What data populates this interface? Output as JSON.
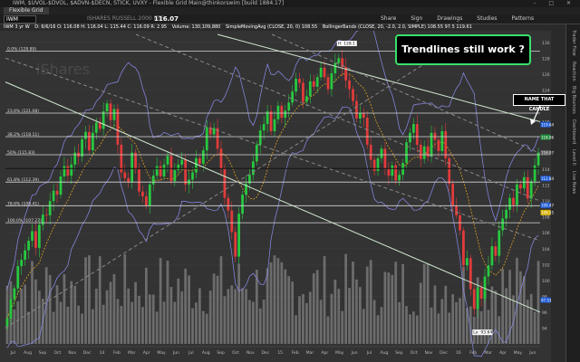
{
  "window": {
    "title": "IWM, $UVOL-$DVOL, $ADVN-$DECN, STICK, UVXY - Flexible Grid Main@thinkorswim [build 1884.17]",
    "controls": "–  □  ✕"
  },
  "tabs": [
    {
      "label": "Flexible Grid"
    }
  ],
  "toolbar": {
    "symbol": "IWM",
    "description": "ISHARES RUSSELL 2000 ETF",
    "last_price": "116.07",
    "buttons": [
      "Share",
      "Sign",
      "Drawings",
      "Studies",
      "Patterns"
    ]
  },
  "studybar": {
    "period": "IWM 3 yr W",
    "quote": "D: 6/6/16  O: 116.08  H: 116.04  L: 115.44  C: 116.09  R: 2.95",
    "volume": "Volume: 130,109,880",
    "sma": "SimpleMovingAvg (CLOSE, 20, 0)  108.55",
    "bollinger": "BollingerBands (CLOSE, 20, -2.0, 2.0, SIMPLE)  108.55  97.5  119.61"
  },
  "annotations": {
    "headline": "Trendlines still work ?",
    "candle_note": "NAME THAT CANDLE",
    "high_label": "H: 128.1",
    "low_label": "Lo: 93.64"
  },
  "sidepanel": {
    "labels": [
      "Trader Flow",
      "Reaction",
      "Big Bounces",
      "Dashboard",
      "Level II",
      "Live News"
    ]
  },
  "chart_data": {
    "type": "candlestick",
    "title": "IWM 3 yr W",
    "xlabel": "",
    "ylabel": "",
    "ylim": [
      92,
      131
    ],
    "x_tick_labels": [
      "Jul",
      "Aug",
      "Sep",
      "Oct",
      "Nov",
      "Dec",
      "14",
      "Feb",
      "Mar",
      "Apr",
      "May",
      "Jun",
      "Jul",
      "Aug",
      "Sep",
      "Oct",
      "Nov",
      "Dec",
      "15",
      "Feb",
      "Mar",
      "Apr",
      "May",
      "Jun",
      "Jul",
      "Aug",
      "Sep",
      "Oct",
      "Nov",
      "Dec",
      "16",
      "Feb",
      "Mar",
      "Apr",
      "May",
      "Jun"
    ],
    "y_tick_labels": [
      94,
      96,
      98,
      100,
      102,
      104,
      106,
      108,
      110,
      112,
      114,
      116,
      118,
      120,
      122,
      124,
      126,
      128,
      130
    ],
    "fibonacci_levels": [
      {
        "label": "0.0% (128.89)",
        "value": 128.89
      },
      {
        "label": "23.6% (121.08)",
        "value": 121.08
      },
      {
        "label": "38.2% (118.11)",
        "value": 118.11
      },
      {
        "label": "50% (115.83)",
        "value": 115.83
      },
      {
        "label": "61.8% (112.39)",
        "value": 112.39
      },
      {
        "label": "78.6% (109.41)",
        "value": 109.41
      },
      {
        "label": "100.0% (107.27)",
        "value": 107.27
      }
    ],
    "price_badges": [
      {
        "value": "119.64",
        "color": "#1e5bd8"
      },
      {
        "value": "118.06",
        "color": "#1f8a3c"
      },
      {
        "value": "116.07",
        "color": "#5a5a5a"
      },
      {
        "value": "112.84",
        "color": "#1e5bd8"
      },
      {
        "value": "109.47",
        "color": "#1e5bd8"
      },
      {
        "value": "108.55",
        "color": "#d9b300"
      },
      {
        "value": "97.53",
        "color": "#1e5bd8"
      }
    ],
    "closes": [
      95.2,
      97.6,
      99.0,
      101.8,
      102.6,
      103.8,
      105.0,
      106.2,
      104.1,
      107.0,
      108.3,
      108.2,
      110.0,
      111.3,
      110.8,
      113.1,
      114.4,
      113.2,
      114.6,
      116.1,
      115.6,
      117.8,
      118.7,
      116.4,
      118.6,
      119.9,
      119.1,
      121.3,
      122.3,
      120.2,
      121.6,
      117.1,
      113.6,
      112.9,
      112.4,
      116.1,
      114.0,
      111.2,
      110.6,
      109.4,
      112.1,
      113.2,
      114.4,
      113.1,
      114.6,
      115.7,
      112.5,
      113.9,
      114.6,
      115.2,
      112.1,
      112.7,
      113.6,
      115.4,
      114.7,
      116.4,
      119.3,
      118.4,
      119.2,
      116.6,
      114.1,
      110.4,
      108.8,
      106.1,
      103.0,
      108.4,
      110.8,
      112.2,
      113.3,
      115.0,
      117.1,
      118.9,
      119.7,
      121.3,
      118.8,
      120.3,
      122.0,
      120.5,
      121.4,
      122.4,
      123.8,
      125.4,
      124.9,
      122.5,
      123.2,
      125.1,
      124.4,
      125.6,
      126.8,
      125.6,
      124.1,
      126.1,
      127.4,
      128.0,
      126.9,
      125.2,
      124.1,
      122.6,
      120.4,
      121.1,
      120.5,
      117.1,
      115.2,
      113.8,
      115.4,
      116.6,
      114.1,
      113.2,
      114.5,
      112.6,
      113.3,
      114.8,
      117.4,
      118.6,
      119.7,
      117.1,
      115.3,
      116.9,
      115.6,
      118.6,
      117.7,
      116.3,
      118.8,
      115.4,
      112.2,
      109.4,
      108.2,
      106.3,
      101.9,
      102.8,
      98.9,
      96.4,
      99.1,
      97.7,
      100.5,
      101.9,
      104.3,
      103.1,
      106.3,
      107.8,
      108.9,
      110.4,
      109.5,
      112.1,
      111.6,
      113.0,
      110.3,
      112.5,
      114.5,
      116.1
    ],
    "volume_series_name": "Volume"
  }
}
